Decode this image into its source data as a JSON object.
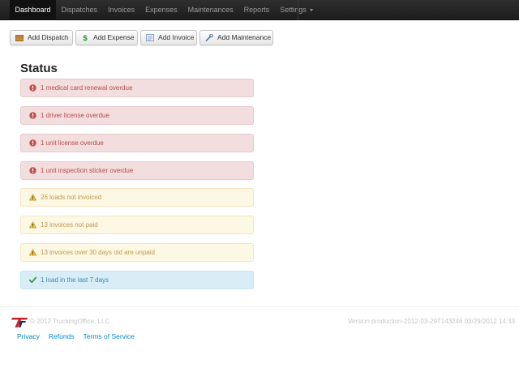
{
  "nav": {
    "items": [
      {
        "label": "Dashboard",
        "active": true
      },
      {
        "label": "Dispatches"
      },
      {
        "label": "Invoices"
      },
      {
        "label": "Expenses"
      },
      {
        "label": "Maintenances"
      },
      {
        "label": "Reports"
      },
      {
        "label": "Settings",
        "dropdown": true
      }
    ]
  },
  "toolbar": {
    "buttons": [
      {
        "label": "Add Dispatch",
        "icon": "box-icon"
      },
      {
        "label": "Add Expense",
        "icon": "dollar-icon"
      },
      {
        "label": "Add Invoice",
        "icon": "invoice-icon"
      },
      {
        "label": "Add Maintenance",
        "icon": "wrench-icon"
      }
    ]
  },
  "status": {
    "title": "Status",
    "alerts": [
      {
        "type": "error",
        "icon": "exclamation-icon",
        "text": "1 medical card renewal overdue"
      },
      {
        "type": "error",
        "icon": "exclamation-icon",
        "text": "1 driver license overdue"
      },
      {
        "type": "error",
        "icon": "exclamation-icon",
        "text": "1 unit license overdue"
      },
      {
        "type": "error",
        "icon": "exclamation-icon",
        "text": "1 unit inspection sticker overdue"
      },
      {
        "type": "warning",
        "icon": "warning-triangle-icon",
        "text": "26 loads not invoiced"
      },
      {
        "type": "warning",
        "icon": "warning-triangle-icon",
        "text": "13 invoices not paid"
      },
      {
        "type": "warning",
        "icon": "warning-triangle-icon",
        "text": "13 invoices over 30 days old are unpaid"
      },
      {
        "type": "info",
        "icon": "checkmark-icon",
        "text": "1 load in the last 7 days"
      }
    ]
  },
  "footer": {
    "copyright": "© 2012 TruckingOffice, LLC",
    "version": "Version production-2012-03-29T143246 03/29/2012 14:33",
    "links": [
      "Privacy",
      "Refunds",
      "Terms of Service"
    ]
  },
  "colors": {
    "navbar": "#222222",
    "link": "#0088cc",
    "error_bg": "#f2dede",
    "error_text": "#b94a48",
    "warning_bg": "#fcf8e3",
    "warning_text": "#c09853",
    "info_bg": "#d9edf7",
    "info_text": "#3a87ad",
    "logo_red": "#cc2222"
  }
}
